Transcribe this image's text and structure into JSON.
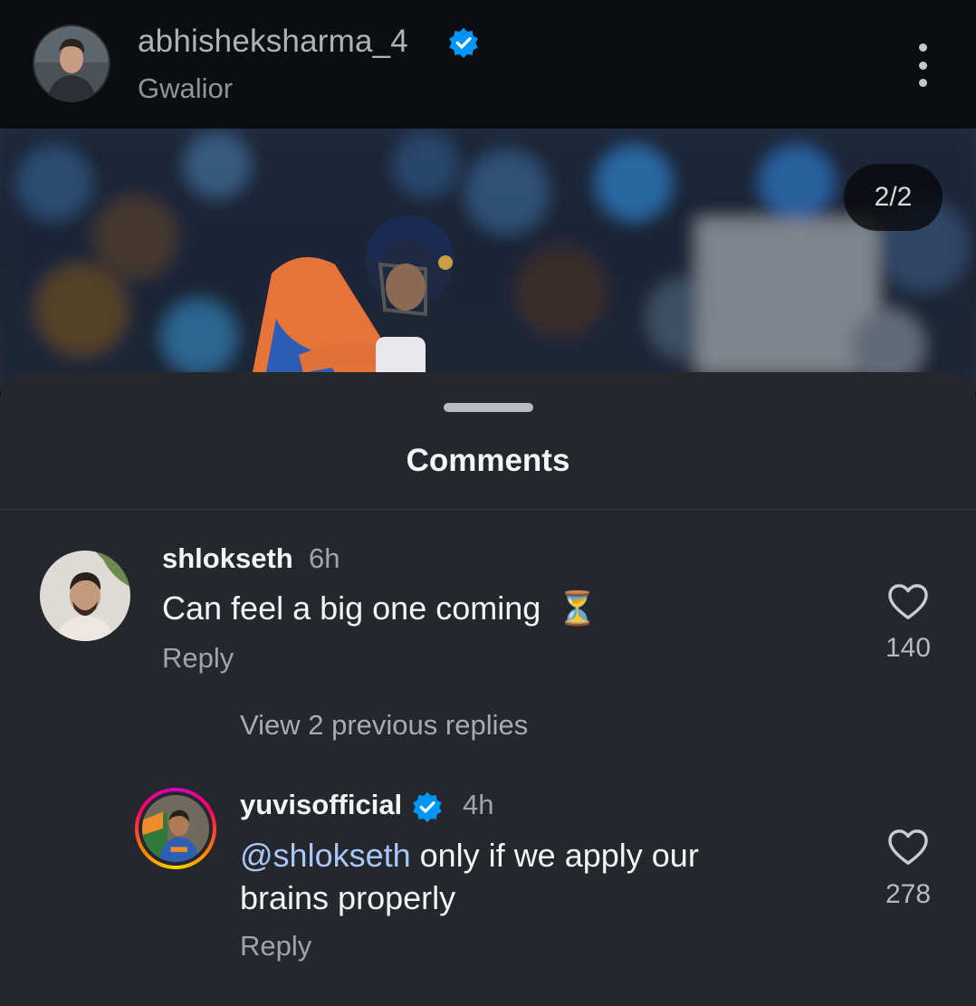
{
  "header": {
    "username": "abhisheksharma_4",
    "location": "Gwalior",
    "verified_icon": "verified-badge-icon",
    "menu_icon": "more-vertical-icon"
  },
  "post": {
    "counter": "2/2"
  },
  "comments_sheet": {
    "title": "Comments",
    "comments": [
      {
        "username": "shlokseth",
        "time": "6h",
        "text": "Can feel a big one coming",
        "emoji": "⏳",
        "reply_label": "Reply",
        "likes": "140"
      }
    ],
    "view_replies_label": "View 2 previous replies",
    "replies": [
      {
        "username": "yuvisofficial",
        "time": "4h",
        "mention": "@shlokseth",
        "text_line1": " only if we apply our",
        "text_line2": "brains properly",
        "reply_label": "Reply",
        "likes": "278"
      }
    ]
  },
  "colors": {
    "sheet_bg": "#25272c",
    "mention": "#a8c7fa",
    "verified": "#0095f6"
  }
}
